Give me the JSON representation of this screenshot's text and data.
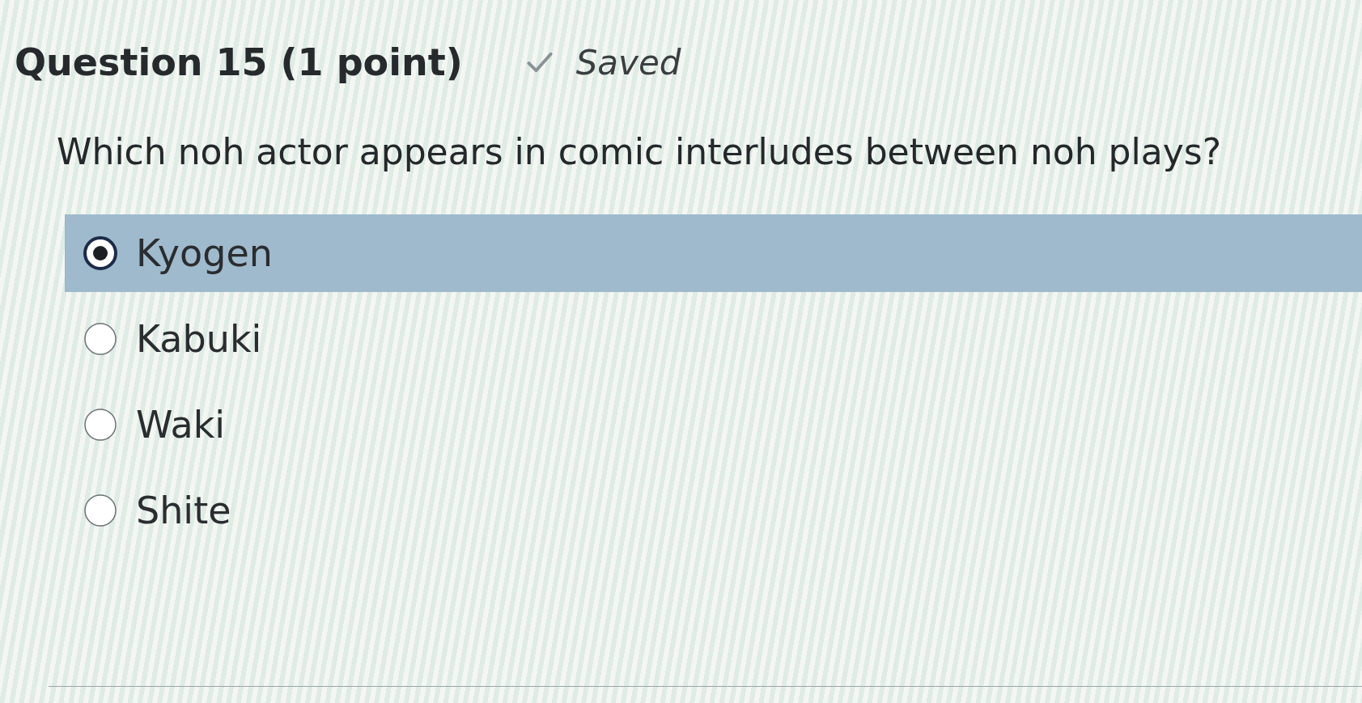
{
  "question": {
    "title": "Question 15 (1 point)",
    "saved": true,
    "status": "Saved",
    "prompt": "Which noh actor appears in comic interludes between noh plays?"
  },
  "options": [
    {
      "label": "Kyogen",
      "selected": true
    },
    {
      "label": "Kabuki",
      "selected": false
    },
    {
      "label": "Waki",
      "selected": false
    },
    {
      "label": "Shite",
      "selected": false
    }
  ]
}
